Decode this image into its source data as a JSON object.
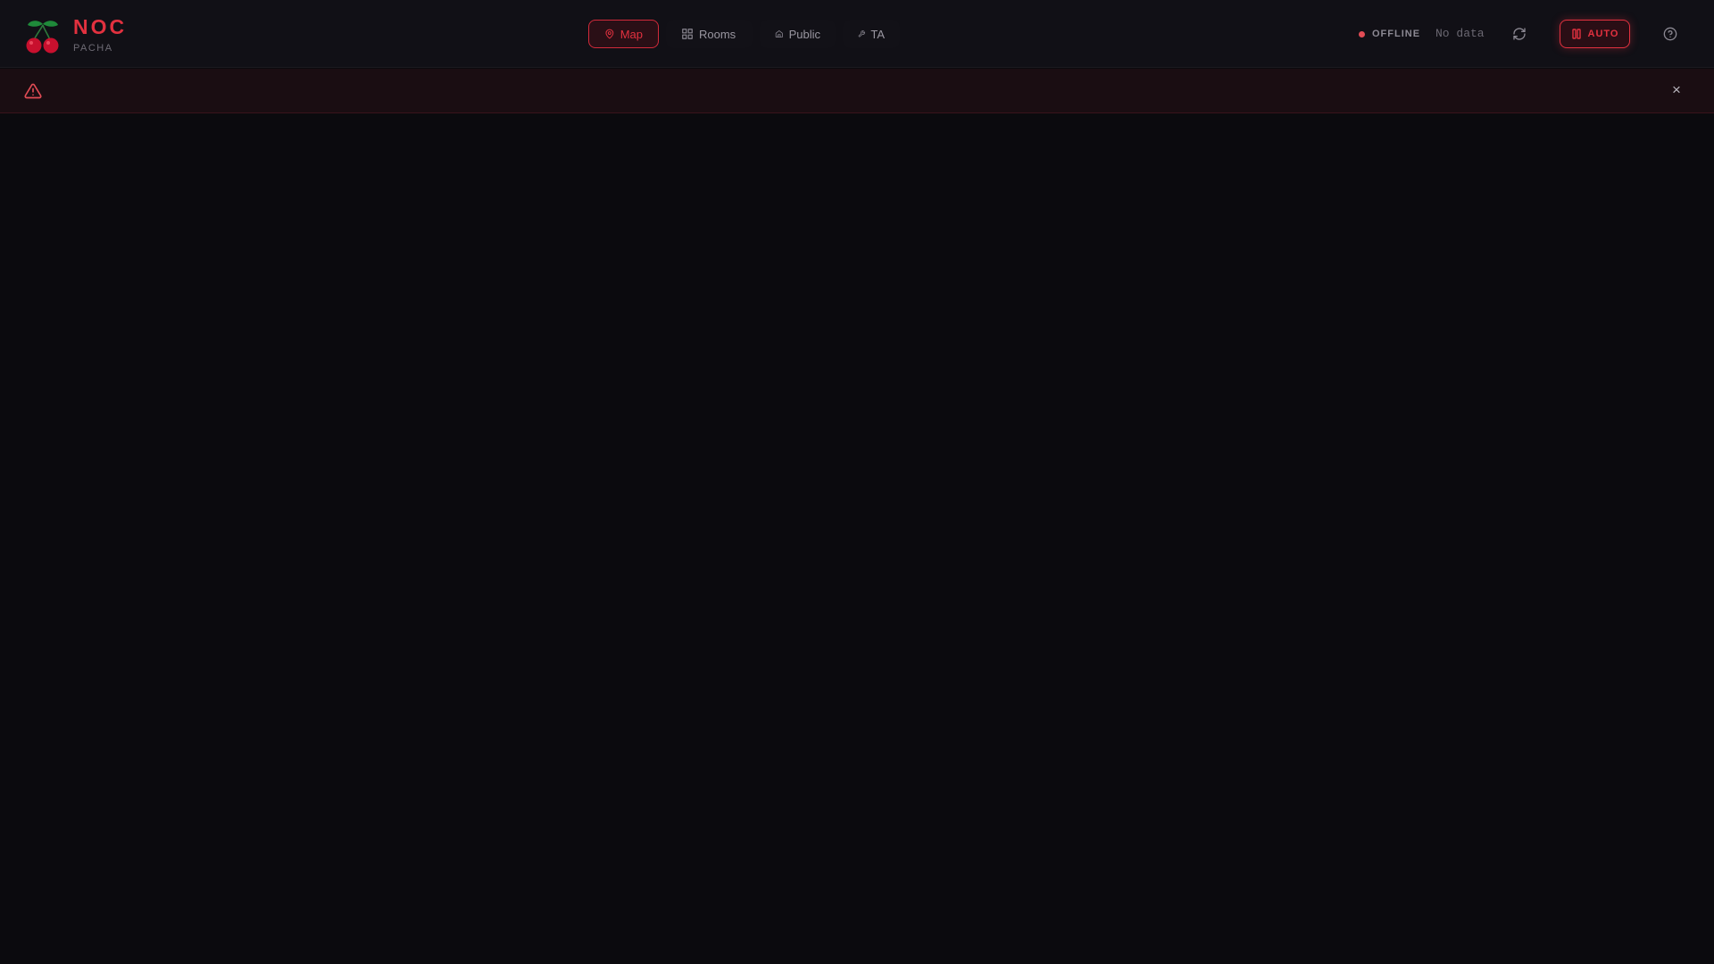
{
  "brand": {
    "title": "NOC",
    "subtitle": "PACHA",
    "logo_icon": "cherry-icon"
  },
  "nav": {
    "items": [
      {
        "label": "Map",
        "icon": "map-pin-icon",
        "active": true
      },
      {
        "label": "Rooms",
        "icon": "grid-icon",
        "active": false
      },
      {
        "label": "Public",
        "icon": "home-icon",
        "active": false
      },
      {
        "label": "TA",
        "icon": "wrench-icon",
        "active": false
      }
    ]
  },
  "status": {
    "label": "OFFLINE",
    "detail": "No data",
    "dot_color": "#e24c55"
  },
  "controls": {
    "refresh_icon": "refresh-icon",
    "auto_label": "AUTO",
    "auto_icon": "pause-icon",
    "help_icon": "help-circle-icon"
  },
  "alert": {
    "icon": "warning-triangle-icon",
    "message": "",
    "close_label": "×"
  },
  "colors": {
    "accent": "#e2313f",
    "background": "#0b0a0e",
    "header": "#111016",
    "alert_bg": "#1a0d12"
  }
}
